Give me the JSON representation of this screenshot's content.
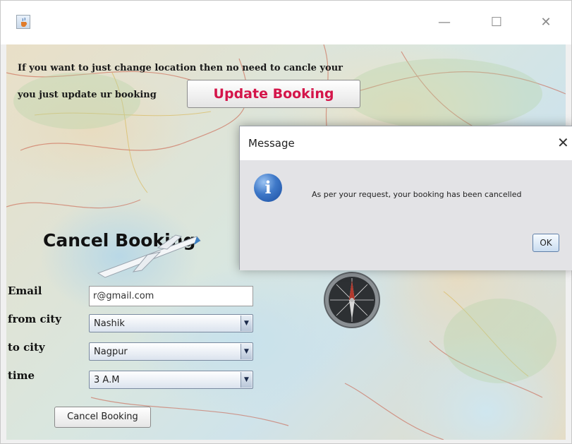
{
  "window": {
    "minimize_glyph": "—",
    "maximize_glyph": "☐",
    "close_glyph": "✕",
    "icon": "java-cup-icon"
  },
  "main": {
    "info_line_1": "If you want to just change location then no need to cancle your",
    "info_line_2": "you just update ur booking",
    "update_button_label": "Update Booking",
    "section_title": "Cancel Booking",
    "form": {
      "email_label": "Email",
      "email_value": "r@gmail.com",
      "from_city_label": "from city",
      "from_city_value": "Nashik",
      "to_city_label": "to city",
      "to_city_value": "Nagpur",
      "time_label": "time",
      "time_value": "3   A.M",
      "dropdown_arrow": "▼"
    },
    "cancel_button_label": "Cancel Booking"
  },
  "dialog": {
    "title": "Message",
    "close_glyph": "✕",
    "icon_glyph": "i",
    "message": "As per your request, your booking has been cancelled",
    "ok_label": "OK"
  },
  "colors": {
    "update_button_text": "#d4154a",
    "info_icon": "#3e78c8"
  }
}
